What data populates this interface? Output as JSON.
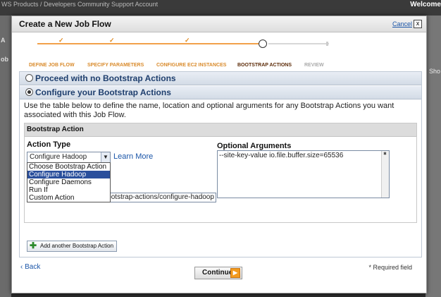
{
  "background": {
    "nav": "WS   Products / Developers   Community   Support   Account",
    "welcome": "Welcome",
    "left_labels": [
      "A",
      "ob"
    ],
    "right_label": "Sho"
  },
  "modal": {
    "title": "Create a New Job Flow",
    "cancel": "Cancel",
    "close_symbol": "x"
  },
  "steps": [
    {
      "label": "DEFINE JOB FLOW",
      "state": "done"
    },
    {
      "label": "SPECIFY PARAMETERS",
      "state": "done"
    },
    {
      "label": "CONFIGURE EC2 INSTANCES",
      "state": "done"
    },
    {
      "label": "BOOTSTRAP ACTIONS",
      "state": "current"
    },
    {
      "label": "REVIEW",
      "state": "future"
    }
  ],
  "options": {
    "none": "Proceed with no Bootstrap Actions",
    "configure": "Configure your Bootstrap Actions",
    "selected": "configure"
  },
  "description": "Use the table below to define the name, location and optional arguments for any Bootstrap Actions you want associated with this Job Flow.",
  "bootstrap": {
    "header": "Bootstrap Action",
    "action_type_label": "Action Type",
    "optional_args_label": "Optional Arguments",
    "selected_value": "Configure Hadoop",
    "learn_more": "Learn More",
    "dropdown_options": [
      "Choose Bootstrap Action",
      "Configure Hadoop",
      "Configure Daemons",
      "Run If",
      "Custom Action"
    ],
    "highlighted_option": 1,
    "s3_location": "s3n://elasticmapreduce/bootstrap-actions/configure-hadoop",
    "args_value": "--site-key-value io.file.buffer.size=65536",
    "add_button": "Add another Bootstrap Action"
  },
  "footer": {
    "back": "Back",
    "continue": "Continue",
    "required": "* Required field"
  },
  "colors": {
    "accent_orange": "#f39a1d",
    "link_blue": "#1a55a8",
    "selected_blue": "#2a4f9c"
  }
}
